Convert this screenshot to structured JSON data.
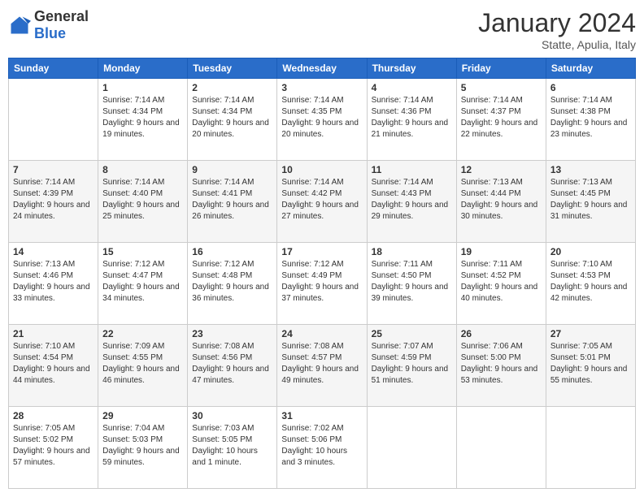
{
  "header": {
    "logo_general": "General",
    "logo_blue": "Blue",
    "month_title": "January 2024",
    "location": "Statte, Apulia, Italy"
  },
  "weekdays": [
    "Sunday",
    "Monday",
    "Tuesday",
    "Wednesday",
    "Thursday",
    "Friday",
    "Saturday"
  ],
  "weeks": [
    [
      {
        "day": "",
        "sunrise": "",
        "sunset": "",
        "daylight": ""
      },
      {
        "day": "1",
        "sunrise": "Sunrise: 7:14 AM",
        "sunset": "Sunset: 4:34 PM",
        "daylight": "Daylight: 9 hours and 19 minutes."
      },
      {
        "day": "2",
        "sunrise": "Sunrise: 7:14 AM",
        "sunset": "Sunset: 4:34 PM",
        "daylight": "Daylight: 9 hours and 20 minutes."
      },
      {
        "day": "3",
        "sunrise": "Sunrise: 7:14 AM",
        "sunset": "Sunset: 4:35 PM",
        "daylight": "Daylight: 9 hours and 20 minutes."
      },
      {
        "day": "4",
        "sunrise": "Sunrise: 7:14 AM",
        "sunset": "Sunset: 4:36 PM",
        "daylight": "Daylight: 9 hours and 21 minutes."
      },
      {
        "day": "5",
        "sunrise": "Sunrise: 7:14 AM",
        "sunset": "Sunset: 4:37 PM",
        "daylight": "Daylight: 9 hours and 22 minutes."
      },
      {
        "day": "6",
        "sunrise": "Sunrise: 7:14 AM",
        "sunset": "Sunset: 4:38 PM",
        "daylight": "Daylight: 9 hours and 23 minutes."
      }
    ],
    [
      {
        "day": "7",
        "sunrise": "Sunrise: 7:14 AM",
        "sunset": "Sunset: 4:39 PM",
        "daylight": "Daylight: 9 hours and 24 minutes."
      },
      {
        "day": "8",
        "sunrise": "Sunrise: 7:14 AM",
        "sunset": "Sunset: 4:40 PM",
        "daylight": "Daylight: 9 hours and 25 minutes."
      },
      {
        "day": "9",
        "sunrise": "Sunrise: 7:14 AM",
        "sunset": "Sunset: 4:41 PM",
        "daylight": "Daylight: 9 hours and 26 minutes."
      },
      {
        "day": "10",
        "sunrise": "Sunrise: 7:14 AM",
        "sunset": "Sunset: 4:42 PM",
        "daylight": "Daylight: 9 hours and 27 minutes."
      },
      {
        "day": "11",
        "sunrise": "Sunrise: 7:14 AM",
        "sunset": "Sunset: 4:43 PM",
        "daylight": "Daylight: 9 hours and 29 minutes."
      },
      {
        "day": "12",
        "sunrise": "Sunrise: 7:13 AM",
        "sunset": "Sunset: 4:44 PM",
        "daylight": "Daylight: 9 hours and 30 minutes."
      },
      {
        "day": "13",
        "sunrise": "Sunrise: 7:13 AM",
        "sunset": "Sunset: 4:45 PM",
        "daylight": "Daylight: 9 hours and 31 minutes."
      }
    ],
    [
      {
        "day": "14",
        "sunrise": "Sunrise: 7:13 AM",
        "sunset": "Sunset: 4:46 PM",
        "daylight": "Daylight: 9 hours and 33 minutes."
      },
      {
        "day": "15",
        "sunrise": "Sunrise: 7:12 AM",
        "sunset": "Sunset: 4:47 PM",
        "daylight": "Daylight: 9 hours and 34 minutes."
      },
      {
        "day": "16",
        "sunrise": "Sunrise: 7:12 AM",
        "sunset": "Sunset: 4:48 PM",
        "daylight": "Daylight: 9 hours and 36 minutes."
      },
      {
        "day": "17",
        "sunrise": "Sunrise: 7:12 AM",
        "sunset": "Sunset: 4:49 PM",
        "daylight": "Daylight: 9 hours and 37 minutes."
      },
      {
        "day": "18",
        "sunrise": "Sunrise: 7:11 AM",
        "sunset": "Sunset: 4:50 PM",
        "daylight": "Daylight: 9 hours and 39 minutes."
      },
      {
        "day": "19",
        "sunrise": "Sunrise: 7:11 AM",
        "sunset": "Sunset: 4:52 PM",
        "daylight": "Daylight: 9 hours and 40 minutes."
      },
      {
        "day": "20",
        "sunrise": "Sunrise: 7:10 AM",
        "sunset": "Sunset: 4:53 PM",
        "daylight": "Daylight: 9 hours and 42 minutes."
      }
    ],
    [
      {
        "day": "21",
        "sunrise": "Sunrise: 7:10 AM",
        "sunset": "Sunset: 4:54 PM",
        "daylight": "Daylight: 9 hours and 44 minutes."
      },
      {
        "day": "22",
        "sunrise": "Sunrise: 7:09 AM",
        "sunset": "Sunset: 4:55 PM",
        "daylight": "Daylight: 9 hours and 46 minutes."
      },
      {
        "day": "23",
        "sunrise": "Sunrise: 7:08 AM",
        "sunset": "Sunset: 4:56 PM",
        "daylight": "Daylight: 9 hours and 47 minutes."
      },
      {
        "day": "24",
        "sunrise": "Sunrise: 7:08 AM",
        "sunset": "Sunset: 4:57 PM",
        "daylight": "Daylight: 9 hours and 49 minutes."
      },
      {
        "day": "25",
        "sunrise": "Sunrise: 7:07 AM",
        "sunset": "Sunset: 4:59 PM",
        "daylight": "Daylight: 9 hours and 51 minutes."
      },
      {
        "day": "26",
        "sunrise": "Sunrise: 7:06 AM",
        "sunset": "Sunset: 5:00 PM",
        "daylight": "Daylight: 9 hours and 53 minutes."
      },
      {
        "day": "27",
        "sunrise": "Sunrise: 7:05 AM",
        "sunset": "Sunset: 5:01 PM",
        "daylight": "Daylight: 9 hours and 55 minutes."
      }
    ],
    [
      {
        "day": "28",
        "sunrise": "Sunrise: 7:05 AM",
        "sunset": "Sunset: 5:02 PM",
        "daylight": "Daylight: 9 hours and 57 minutes."
      },
      {
        "day": "29",
        "sunrise": "Sunrise: 7:04 AM",
        "sunset": "Sunset: 5:03 PM",
        "daylight": "Daylight: 9 hours and 59 minutes."
      },
      {
        "day": "30",
        "sunrise": "Sunrise: 7:03 AM",
        "sunset": "Sunset: 5:05 PM",
        "daylight": "Daylight: 10 hours and 1 minute."
      },
      {
        "day": "31",
        "sunrise": "Sunrise: 7:02 AM",
        "sunset": "Sunset: 5:06 PM",
        "daylight": "Daylight: 10 hours and 3 minutes."
      },
      {
        "day": "",
        "sunrise": "",
        "sunset": "",
        "daylight": ""
      },
      {
        "day": "",
        "sunrise": "",
        "sunset": "",
        "daylight": ""
      },
      {
        "day": "",
        "sunrise": "",
        "sunset": "",
        "daylight": ""
      }
    ]
  ]
}
